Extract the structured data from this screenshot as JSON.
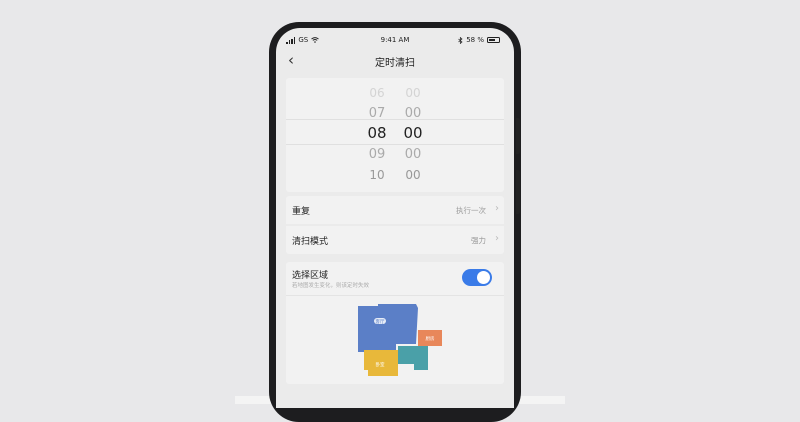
{
  "status_bar": {
    "carrier": "GS",
    "time": "9:41 AM",
    "battery": "58 %",
    "icons": [
      "signal-icon",
      "wifi-icon",
      "bluetooth-icon",
      "battery-icon"
    ]
  },
  "header": {
    "title": "定时清扫",
    "back_icon": "back-chevron-icon"
  },
  "time_picker": {
    "hours": [
      "06",
      "07",
      "08",
      "09",
      "10"
    ],
    "minutes": [
      "00",
      "00",
      "00",
      "00",
      "00"
    ],
    "selected_hour": "08",
    "selected_minute": "00"
  },
  "settings": {
    "repeat": {
      "label": "重复",
      "value": "执行一次"
    },
    "mode": {
      "label": "清扫模式",
      "value": "强力"
    }
  },
  "area": {
    "label": "选择区域",
    "hint": "若地图发生变化，则该定时失效",
    "toggle_on": true,
    "room_labels": [
      "客厅",
      "厨房",
      "卧室"
    ]
  },
  "colors": {
    "accent": "#3a7be8",
    "room_blue": "#5b7fc7",
    "room_orange": "#e8875a",
    "room_teal": "#4aa0a8",
    "room_yellow": "#e8b83a"
  }
}
